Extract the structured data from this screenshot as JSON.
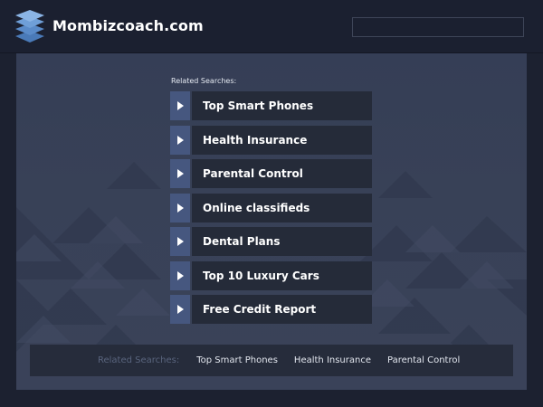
{
  "header": {
    "site_name": "Mombizcoach.com",
    "logo_icon": "stacked-layers-icon",
    "search": {
      "value": "",
      "placeholder": ""
    }
  },
  "main": {
    "related_label": "Related Searches:",
    "links": [
      {
        "label": "Top Smart Phones",
        "icon": "play-arrow-icon"
      },
      {
        "label": "Health Insurance",
        "icon": "play-arrow-icon"
      },
      {
        "label": "Parental Control",
        "icon": "play-arrow-icon"
      },
      {
        "label": "Online classifieds",
        "icon": "play-arrow-icon"
      },
      {
        "label": "Dental Plans",
        "icon": "play-arrow-icon"
      },
      {
        "label": "Top 10 Luxury Cars",
        "icon": "play-arrow-icon"
      },
      {
        "label": "Free Credit Report",
        "icon": "play-arrow-icon"
      }
    ]
  },
  "footer_bar": {
    "label": "Related Searches:",
    "links": [
      "Top Smart Phones",
      "Health Insurance",
      "Parental Control"
    ]
  },
  "colors": {
    "page_bg": "#1c2130",
    "panel_bg": "#384157",
    "arrow_box": "#46577f",
    "link_box": "#252b39",
    "footer_label": "#59647d"
  }
}
